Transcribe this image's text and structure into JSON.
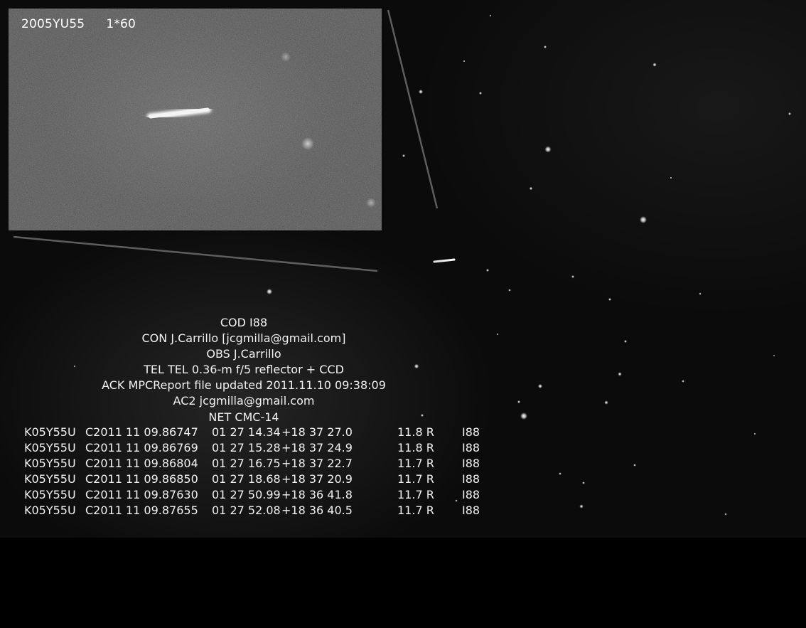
{
  "inset": {
    "designation": "2005YU55",
    "exposure": "1*60"
  },
  "mpc_header": [
    "COD I88",
    "CON J.Carrillo [jcgmilla@gmail.com]",
    "OBS J.Carrillo",
    "TEL TEL 0.36-m f/5 reflector + CCD",
    "ACK MPCReport file updated 2011.11.10 09:38:09",
    "AC2 jcgmilla@gmail.com",
    "NET CMC-14"
  ],
  "observations": [
    {
      "designation": "K05Y55U",
      "date": "C2011 11 09.86747",
      "ra": "01 27 14.34",
      "dec": "+18 37 27.0",
      "mag": "11.8 R",
      "code": "I88"
    },
    {
      "designation": "K05Y55U",
      "date": "C2011 11 09.86769",
      "ra": "01 27 15.28",
      "dec": "+18 37 24.9",
      "mag": "11.8 R",
      "code": "I88"
    },
    {
      "designation": "K05Y55U",
      "date": "C2011 11 09.86804",
      "ra": "01 27 16.75",
      "dec": "+18 37 22.7",
      "mag": "11.7 R",
      "code": "I88"
    },
    {
      "designation": "K05Y55U",
      "date": "C2011 11 09.86850",
      "ra": "01 27 18.68",
      "dec": "+18 37 20.9",
      "mag": "11.7 R",
      "code": "I88"
    },
    {
      "designation": "K05Y55U",
      "date": "C2011 11 09.87630",
      "ra": "01 27 50.99",
      "dec": "+18 36 41.8",
      "mag": "11.7 R",
      "code": "I88"
    },
    {
      "designation": "K05Y55U",
      "date": "C2011 11 09.87655",
      "ra": "01 27 52.08",
      "dec": "+18 36 40.5",
      "mag": "11.7 R",
      "code": "I88"
    }
  ]
}
